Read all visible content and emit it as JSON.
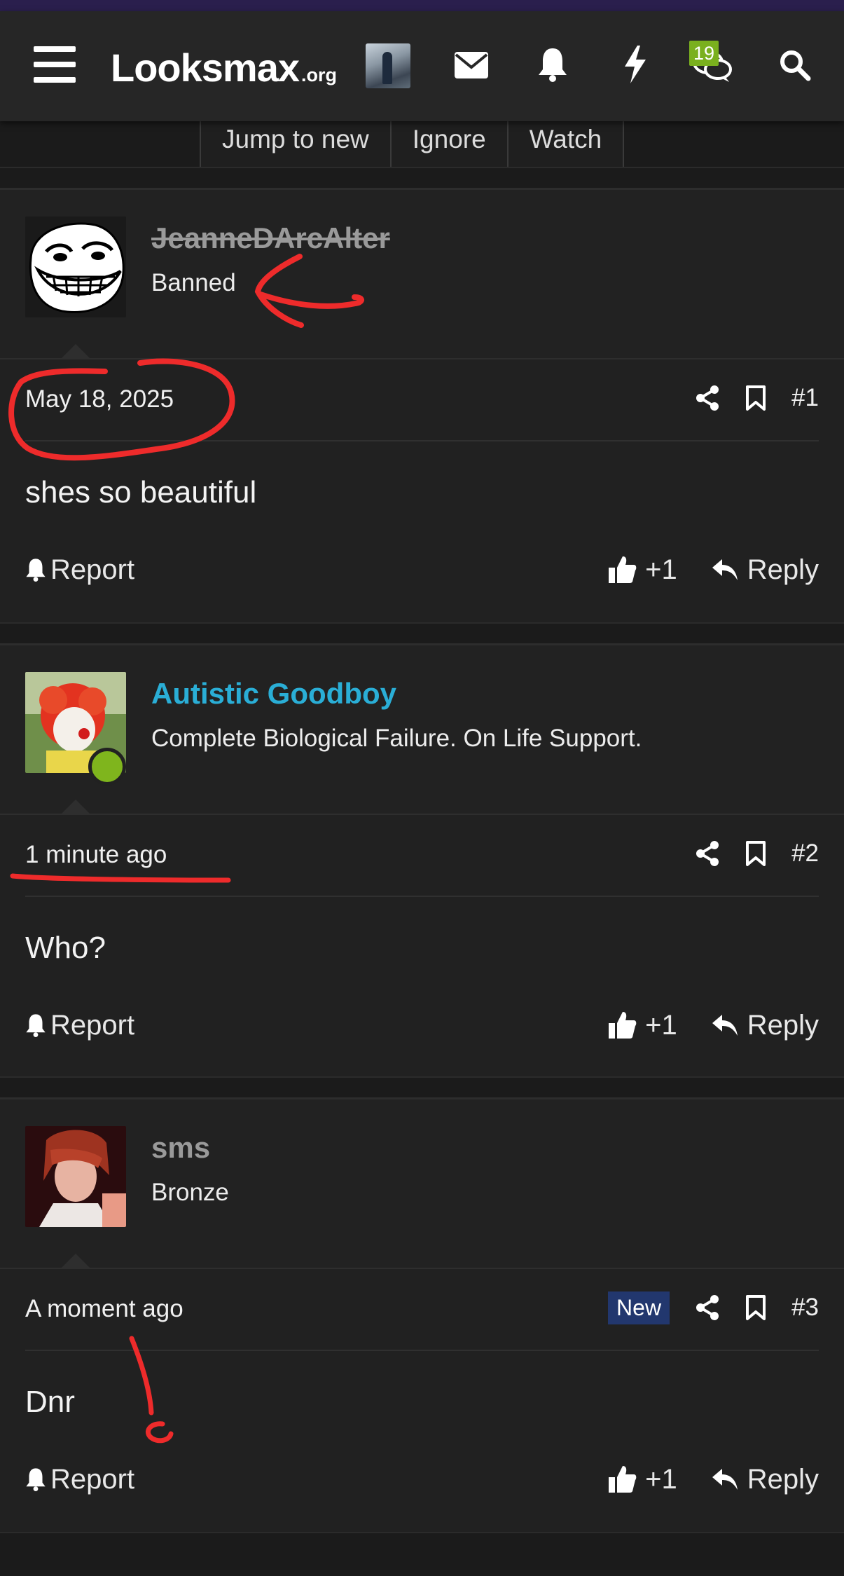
{
  "header": {
    "logo_main": "Looksmax",
    "logo_suffix": ".org",
    "conversations_badge": "19",
    "icons": [
      "menu-icon",
      "envelope-icon",
      "bell-icon",
      "bolt-icon",
      "chat-icon",
      "search-icon"
    ]
  },
  "thread_buttons": [
    "Jump to new",
    "Ignore",
    "Watch"
  ],
  "posts": [
    {
      "author": "JeanneDArcAlter",
      "author_banned": true,
      "user_title": "Banned",
      "time": "May 18, 2025",
      "new_badge": "",
      "number": "#1",
      "body": "shes so beautiful",
      "report_label": "Report",
      "like_label": "+1",
      "reply_label": "Reply"
    },
    {
      "author": "Autistic Goodboy",
      "author_color": "#2aaed6",
      "online": true,
      "user_title": "Complete Biological Failure. On Life Support.",
      "time": "1 minute ago",
      "new_badge": "",
      "number": "#2",
      "body": "Who?",
      "report_label": "Report",
      "like_label": "+1",
      "reply_label": "Reply"
    },
    {
      "author": "sms",
      "author_color": "#9a9a9a",
      "user_title": "Bronze",
      "time": "A moment ago",
      "new_badge": "New",
      "number": "#3",
      "body": "Dnr",
      "report_label": "Report",
      "like_label": "+1",
      "reply_label": "Reply"
    }
  ],
  "colors": {
    "background": "#1b1b1b",
    "post_background": "#212121",
    "annotation_red": "#ee2b2b",
    "online_green": "#7fb51d",
    "new_badge_bg": "#22376e"
  }
}
